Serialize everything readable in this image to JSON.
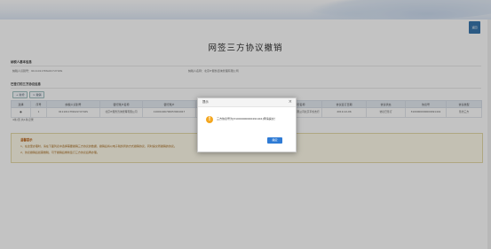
{
  "header": {
    "top_button": "返回"
  },
  "page_title": "网签三方协议撤销",
  "taxpayer_section": {
    "heading": "纳税人基本信息",
    "fields": [
      {
        "label": "纳税人识别号：",
        "value": "91110117MA01YUY16S"
      },
      {
        "label": "纳税人名称：",
        "value": "北京IT服务咨询管理有限公司"
      }
    ]
  },
  "agreement_section": {
    "heading": "已签订的三方协议信息",
    "buttons": [
      "+ 新增",
      "× 撤销"
    ],
    "columns": [
      "选择",
      "序号",
      "纳税人识别号",
      "银行账户名称",
      "银行账户",
      "开户行",
      "清算行",
      "开户银行名称",
      "协议签订日期",
      "协议状态",
      "协议号",
      "协议类型"
    ],
    "rows": [
      {
        "select": "●",
        "index": "1",
        "taxpayer_id": "91110117MA01YUY16S",
        "account_name": "北京IT服务咨询管理有限公司",
        "account": "11001046700053004917",
        "open_bank": "105100...",
        "clear_bank": "105100000017",
        "open_bank_name": "中国建设银行股份有限公司北京平谷支行",
        "sign_date": "2019-12-06",
        "status": "协议已签订",
        "agreement_no": "3100000000000491441",
        "type": "签约三方"
      }
    ],
    "pagination": "4条/页  共1条记录"
  },
  "tips": {
    "title": "温馨提示",
    "lines": [
      "1、在这里办理时，请在下面列表中选择需要撤销三方协议的数据，撤销后将以电子税务局的方式撤销协议，同时提交所撤销的协议。",
      "2、协议撤销后如需缴税，可于撤销后重新签订三方协议后再办理。"
    ]
  },
  "dialog": {
    "title": "提示",
    "close": "×",
    "icon": "!",
    "message": "三方协议号为[31000000000491441]申请提交！",
    "ok_label": "确定"
  }
}
